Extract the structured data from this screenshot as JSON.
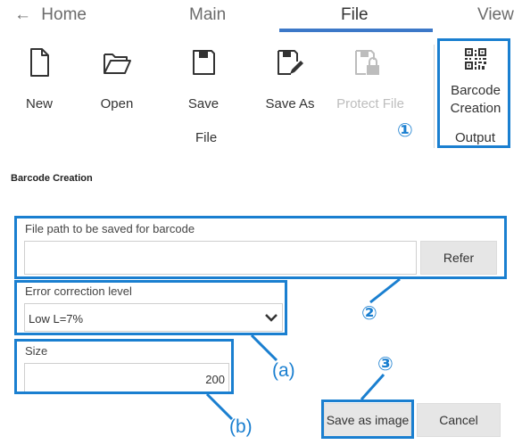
{
  "tabs": {
    "home": "Home",
    "main": "Main",
    "file": "File",
    "view": "View"
  },
  "ribbon": {
    "new": "New",
    "open": "Open",
    "save": "Save",
    "save_as": "Save As",
    "protect_file": "Protect File",
    "barcode_line1": "Barcode",
    "barcode_line2": "Creation",
    "file_group": "File",
    "output_group": "Output"
  },
  "form": {
    "title": "Barcode Creation",
    "file_path_label": "File path to be saved for barcode",
    "file_path_value": "",
    "refer_button": "Refer",
    "error_level_label": "Error correction level",
    "error_level_value": "Low L=7%",
    "size_label": "Size",
    "size_value": "200",
    "save_image_button": "Save as image",
    "cancel_button": "Cancel"
  },
  "annotations": {
    "c1": "①",
    "c2": "②",
    "c3": "③",
    "a": "(a)",
    "b": "(b)"
  },
  "colors": {
    "highlight": "#1a7fd0",
    "tab_underline": "#3c78c8",
    "button_bg": "#e6e6e6"
  }
}
